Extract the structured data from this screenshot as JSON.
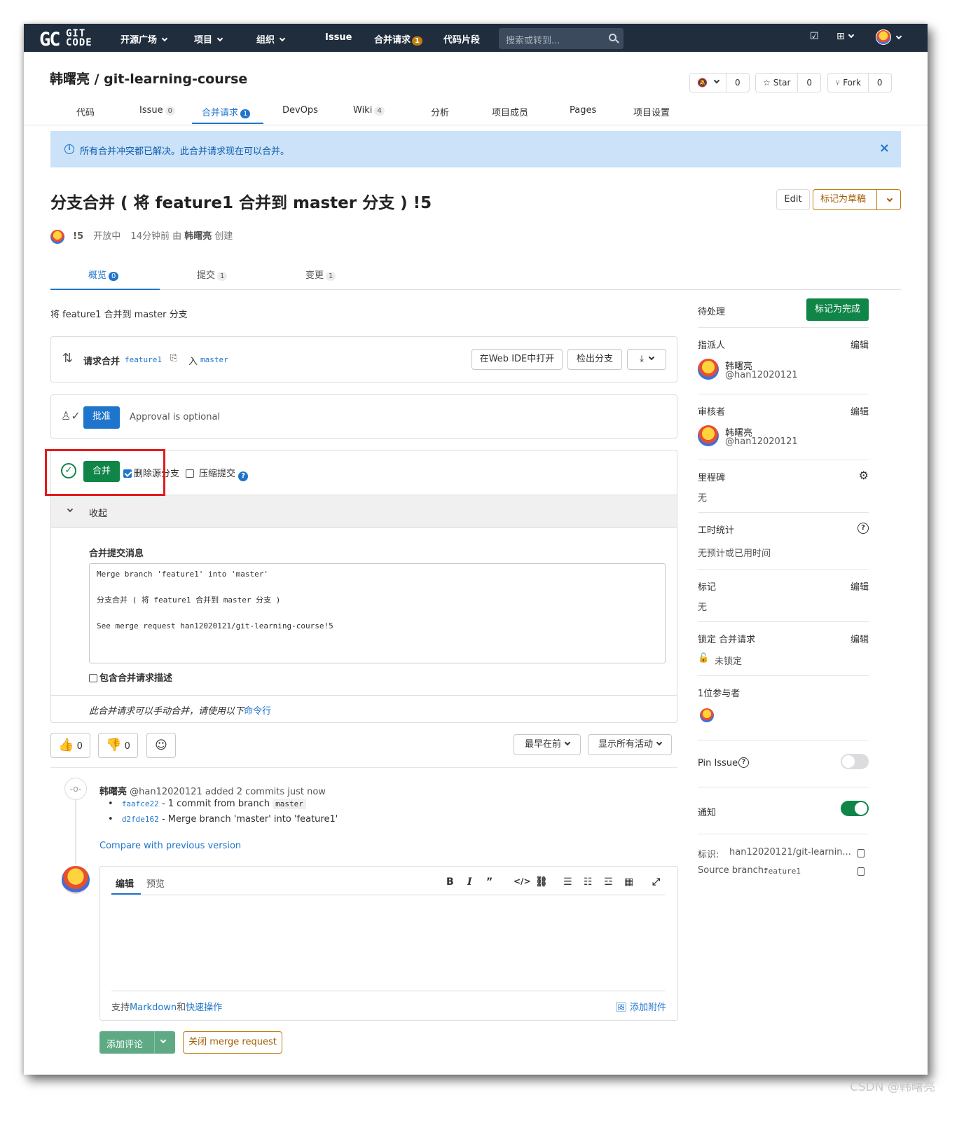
{
  "topnav": {
    "logo": "GC",
    "logo_sub": "GIT CODE",
    "items": [
      "开源广场",
      "项目",
      "组织",
      "Issue",
      "合并请求",
      "代码片段"
    ],
    "mr_badge": "1",
    "search_placeholder": "搜索或转到..."
  },
  "project": {
    "breadcrumb": "韩曙亮 / git-learning-course",
    "star_label": "Star",
    "star_count": "0",
    "fork_label": "Fork",
    "fork_count": "0",
    "notify_count": "0"
  },
  "project_tabs": [
    {
      "label": "代码",
      "count": ""
    },
    {
      "label": "Issue",
      "count": "0"
    },
    {
      "label": "合并请求",
      "count": "1"
    },
    {
      "label": "DevOps",
      "count": ""
    },
    {
      "label": "Wiki",
      "count": "4"
    },
    {
      "label": "分析",
      "count": ""
    },
    {
      "label": "项目成员",
      "count": ""
    },
    {
      "label": "Pages",
      "count": ""
    },
    {
      "label": "项目设置",
      "count": ""
    }
  ],
  "alert": {
    "text": "所有合并冲突都已解决。此合并请求现在可以合并。",
    "close": "×"
  },
  "mr": {
    "title": "分支合并 ( 将 feature1 合并到 master 分支 ) !5",
    "edit_label": "Edit",
    "draft_label": "标记为草稿",
    "id": "!5",
    "status": "开放中",
    "created": "14分钟前 由",
    "author": "韩曙亮",
    "created_suffix": "创建",
    "subtabs": [
      {
        "label": "概览",
        "count": "0"
      },
      {
        "label": "提交",
        "count": "1"
      },
      {
        "label": "变更",
        "count": "1"
      }
    ],
    "description": "将 feature1 合并到 master 分支"
  },
  "branch": {
    "prefix": "请求合并",
    "source": "feature1",
    "into": "入",
    "target": "master",
    "open_ide": "在Web IDE中打开",
    "checkout": "检出分支"
  },
  "approval": {
    "button": "批准",
    "text": "Approval is optional"
  },
  "merge": {
    "button": "合并",
    "delete_source": "删除源分支",
    "delete_checked": true,
    "squash": "压缩提交",
    "collapse": "收起",
    "message_label": "合并提交消息",
    "message_lines": [
      "Merge branch 'feature1' into 'master'",
      "分支合并 ( 将 feature1 合并到 master 分支 )",
      "See merge request han12020121/git-learning-course!5"
    ],
    "include_desc": "包含合并请求描述",
    "manual_text": "此合并请求可以手动合并，请使用以下",
    "manual_link": "命令行"
  },
  "reactions": {
    "thumbs_up": "0",
    "thumbs_down": "0"
  },
  "sort": {
    "order": "最早在前",
    "filter": "显示所有活动"
  },
  "activity": {
    "author": "韩曙亮",
    "handle": "@han12020121",
    "action": "added 2 commits just now",
    "commits": [
      {
        "sha": "faafce22",
        "text": "- 1 commit from branch",
        "branch": "master"
      },
      {
        "sha": "d2fde162",
        "text": "- Merge branch 'master' into 'feature1'"
      }
    ],
    "compare": "Compare with previous version"
  },
  "comment": {
    "tab_write": "编辑",
    "tab_preview": "预览",
    "footer_prefix": "支持",
    "markdown": "Markdown",
    "and": "和",
    "quick_actions": "快速操作",
    "attach": "添加附件",
    "submit": "添加评论",
    "close_mr": "关闭 merge request"
  },
  "sidebar": {
    "todo": "待处理",
    "mark_done": "标记为完成",
    "assignee_label": "指派人",
    "edit": "编辑",
    "assignee_name": "韩曙亮",
    "assignee_handle": "@han12020121",
    "reviewer_label": "审核者",
    "reviewer_name": "韩曙亮",
    "reviewer_handle": "@han12020121",
    "milestone_label": "里程碑",
    "milestone_value": "无",
    "time_label": "工时统计",
    "time_value": "无预计或已用时间",
    "labels_label": "标记",
    "labels_value": "无",
    "lock_label": "锁定 合并请求",
    "lock_value": "未锁定",
    "participants": "1位参与者",
    "pin_issue": "Pin Issue",
    "notifications": "通知",
    "reference_label": "标识:",
    "reference_value": "han12020121/git-learnin...",
    "source_branch_label": "Source branch:",
    "source_branch_value": "feature1"
  },
  "watermark": "CSDN @韩曙亮",
  "colors": {
    "nav_bg": "#1f2d3d",
    "accent": "#1f75cb",
    "success": "#108548",
    "warning": "#c17d10",
    "highlight": "#e21c1c"
  }
}
